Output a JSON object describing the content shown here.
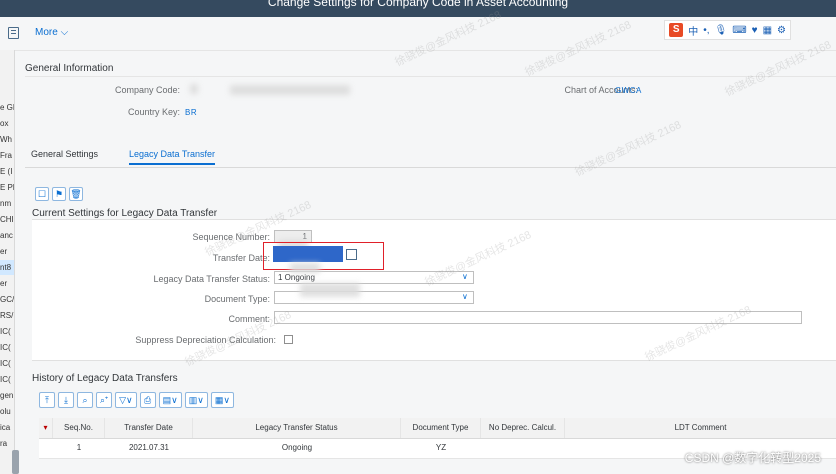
{
  "window": {
    "title": "Change Settings for Company Code in Asset Accounting"
  },
  "toolbar": {
    "more_label": "More"
  },
  "ime": {
    "s": "S",
    "zh": "中"
  },
  "left_strip": [
    "e GL",
    "ox",
    "Wh",
    "Fra",
    "E (I",
    "E Pl",
    "nm",
    "CHI",
    "anc",
    "er",
    "nt8",
    "er",
    "GC/",
    "RS/",
    "IC(",
    "IC(",
    "IC(",
    "IC(",
    "gen",
    "olu",
    "ica",
    "ra"
  ],
  "general": {
    "title": "General Information",
    "company_code_label": "Company Code:",
    "country_key_label": "Country Key:",
    "country_key_value": "BR",
    "chart_label": "Chart of Accounts:",
    "chart_value": "GWCA"
  },
  "tabs": [
    {
      "label": "General Settings"
    },
    {
      "label": "Legacy Data Transfer"
    }
  ],
  "current": {
    "title": "Current Settings for Legacy Data Transfer",
    "seq_label": "Sequence Number:",
    "seq_value": "1",
    "date_label": "Transfer Date:",
    "status_label": "Legacy Data Transfer Status:",
    "status_value": "1 Ongoing",
    "doctype_label": "Document Type:",
    "comment_label": "Comment:",
    "suppress_label": "Suppress Depreciation Calculation:"
  },
  "history": {
    "title": "History of Legacy Data Transfers",
    "columns": [
      "Seq.No.",
      "Transfer Date",
      "Legacy Transfer Status",
      "Document Type",
      "No Deprec. Calcul.",
      "LDT Comment"
    ],
    "rows": [
      {
        "seq": "1",
        "date": "2021.07.31",
        "status": "Ongoing",
        "doctype": "YZ",
        "nodep": "",
        "comment": ""
      }
    ]
  },
  "watermark": {
    "csdn": "CSDN @数字化转型2025",
    "overlay": "徐骁俊@金风科技 2168"
  }
}
